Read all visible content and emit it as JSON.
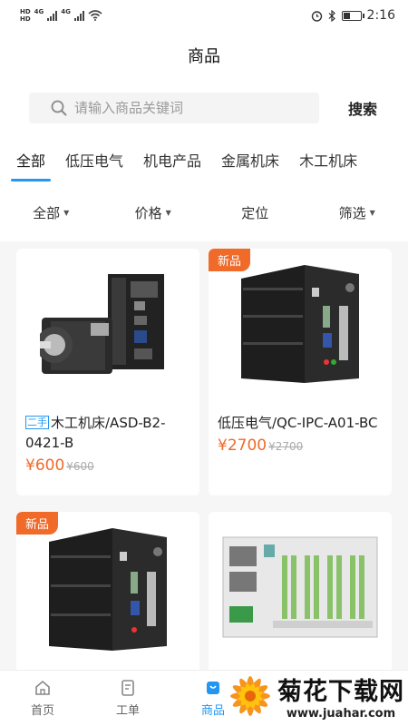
{
  "status_bar": {
    "hd1": "HD",
    "hd2": "HD",
    "net1": "4G",
    "net2": "4G",
    "time": "2:16",
    "battery_level": 0.35
  },
  "header": {
    "title": "商品"
  },
  "search": {
    "placeholder": "请输入商品关键词",
    "value": "",
    "button_label": "搜索"
  },
  "tabs": [
    {
      "label": "全部",
      "active": true
    },
    {
      "label": "低压电气",
      "active": false
    },
    {
      "label": "机电产品",
      "active": false
    },
    {
      "label": "金属机床",
      "active": false
    },
    {
      "label": "木工机床",
      "active": false
    }
  ],
  "filters": [
    {
      "label": "全部",
      "has_caret": true
    },
    {
      "label": "价格",
      "has_caret": true
    },
    {
      "label": "定位",
      "has_caret": false
    },
    {
      "label": "筛选",
      "has_caret": true
    }
  ],
  "products": [
    {
      "badge": "",
      "condition_tag": "二手",
      "title": "木工机床/ASD-B2-0421-B",
      "price": "¥600",
      "original_price": "¥600",
      "image": "servo-motor-drive"
    },
    {
      "badge": "新品",
      "condition_tag": "",
      "title": "低压电气/QC-IPC-A01-BC",
      "price": "¥2700",
      "original_price": "¥2700",
      "image": "industrial-pc"
    },
    {
      "badge": "新品",
      "condition_tag": "",
      "title": "",
      "price": "",
      "original_price": "",
      "image": "industrial-pc"
    },
    {
      "badge": "",
      "condition_tag": "",
      "title": "",
      "price": "",
      "original_price": "",
      "image": "digital-output-module"
    }
  ],
  "bottom_nav": [
    {
      "label": "首页",
      "icon": "home-icon",
      "active": false
    },
    {
      "label": "工单",
      "icon": "work-order-icon",
      "active": false
    },
    {
      "label": "商品",
      "icon": "product-icon",
      "active": true
    }
  ],
  "watermark": {
    "title": "菊花下载网",
    "url": "www.juahar.com"
  },
  "colors": {
    "accent": "#2196f3",
    "price": "#f06a2a",
    "badge": "#f06a2a"
  }
}
